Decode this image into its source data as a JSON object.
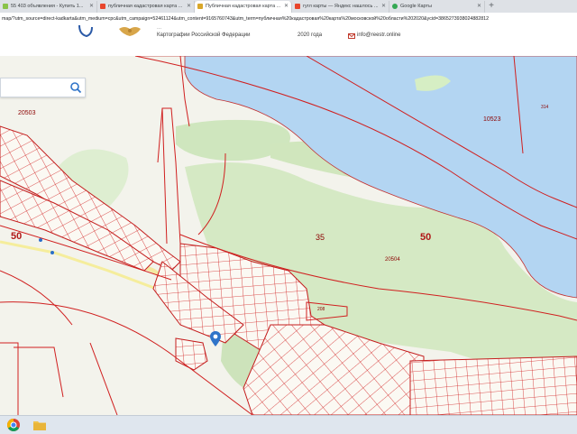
{
  "browser": {
    "tabs": [
      {
        "title": "55 403 объявления - Купить 1...",
        "active": false
      },
      {
        "title": "публичная кадастровая карта ...",
        "active": false
      },
      {
        "title": "Публичная кадастровая карта ...",
        "active": true
      },
      {
        "title": "гугл карты — Яндекс нашлось ...",
        "active": false
      },
      {
        "title": "Google Карты",
        "active": false
      }
    ],
    "new_tab": "+",
    "url": "map/?utm_source=direct-kadkarta&utm_medium=cpc&utm_campaign=52461124&utm_content=9165760743&utm_term=публичная%20кадастровая%20карта%20московской%20области%202020&ycid=3865273938024882812"
  },
  "site_header": {
    "org_line1": "Картографии Российской Федерации",
    "org_line2": "...",
    "year_text": "2020 года",
    "email": "info@reestr.online"
  },
  "search": {
    "placeholder": "",
    "value": ""
  },
  "map": {
    "labels": {
      "l_20503": "20503",
      "l_10523": "10523",
      "l_35": "35",
      "l_50_left": "50",
      "l_50_right": "50",
      "l_20504": "20504",
      "l_208": "208",
      "l_314": "314"
    }
  },
  "colors": {
    "water": "#b3d5f2",
    "green": "#cfe6be",
    "parcel_line": "#cc1f1f",
    "road": "#f6eda0"
  },
  "icons": [
    "search-icon",
    "map-marker-icon",
    "chrome-icon",
    "folder-icon"
  ]
}
